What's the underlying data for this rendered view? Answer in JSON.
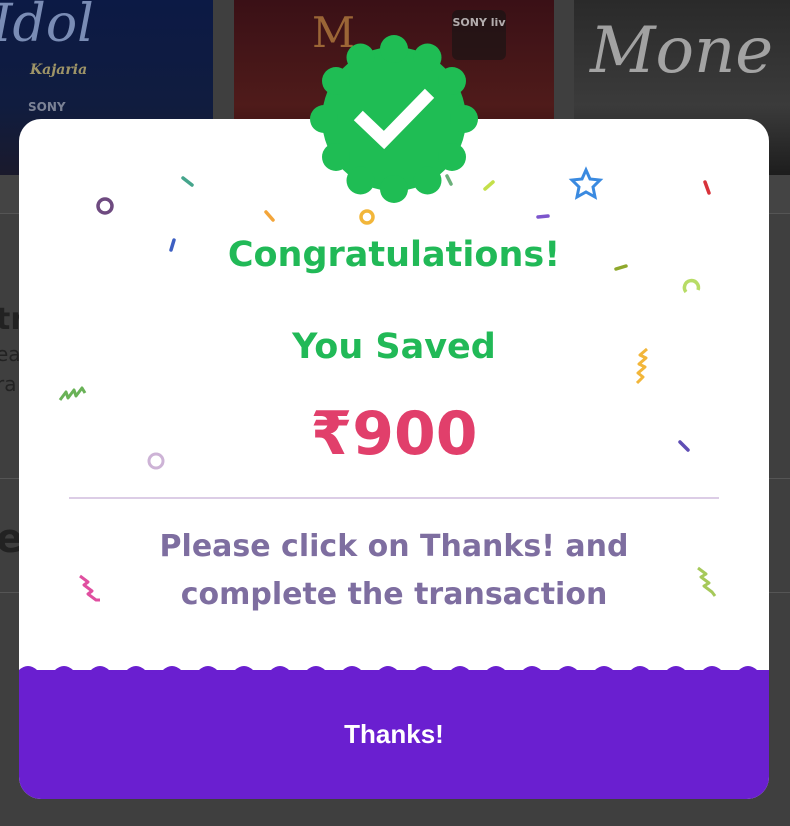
{
  "background": {
    "tile1_title": "Idol",
    "tile1_subtitle": "Kajaria",
    "tile1_logo": "SONY",
    "tile2_badge": "SONY liv",
    "tile2_mark": "M",
    "tile3_title": "Mone",
    "left_fragments": [
      "tr",
      "ea",
      "ra",
      "e"
    ]
  },
  "modal": {
    "badge_icon": "check-badge-icon",
    "title": "Congratulations!",
    "saved_label": "You Saved",
    "amount": "₹900",
    "message_line1": "Please click on Thanks! and",
    "message_line2": "complete the transaction",
    "button_label": "Thanks!"
  },
  "colors": {
    "success_green": "#21b957",
    "amount_pink": "#e13f6b",
    "footer_purple": "#6a1fd0",
    "message_purple": "#7e6ea0"
  }
}
